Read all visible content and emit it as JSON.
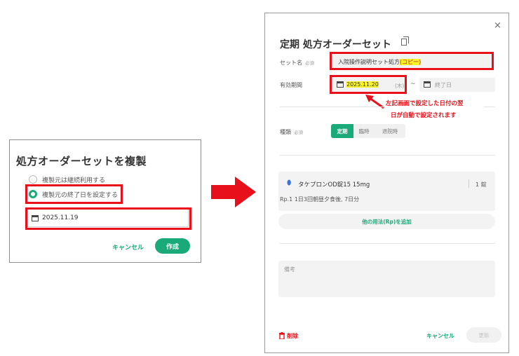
{
  "left_dialog": {
    "title": "処方オーダーセットを複製",
    "options": [
      {
        "label": "複製元は継続利用する",
        "selected": false
      },
      {
        "label": "複製元の終了日を設定する",
        "selected": true
      }
    ],
    "date_value": "2025.11.19",
    "cancel_label": "キャンセル",
    "create_label": "作成"
  },
  "right_dialog": {
    "close_label": "×",
    "title": "定期 処方オーダーセット",
    "set_name": {
      "label": "セット名",
      "required": "必須",
      "value_main": "入院操作説明セット処方",
      "value_suffix": "(コピー)"
    },
    "valid_period": {
      "label": "有効期間",
      "start_date": "2025.11.20",
      "start_weekday": "(木)",
      "separator": "~",
      "end_placeholder": "終了日"
    },
    "annotation": {
      "line1": "左記画面で設定した日付の翌",
      "line2": "日が自動で設定されます"
    },
    "type": {
      "label": "種類",
      "required": "必須",
      "options": [
        "定期",
        "臨時",
        "退院時"
      ],
      "active_index": 0
    },
    "prescription": {
      "drug": "タケプロンOD錠15 15mg",
      "quantity": "1 錠",
      "rp_text": "Rp.1  1日3回朝昼夕食後, 7日分"
    },
    "add_rp_label": "他の用法(Rp)を追加",
    "notes_placeholder": "備考",
    "delete_label": "削除",
    "cancel_label": "キャンセル",
    "update_label": "更新"
  },
  "colors": {
    "accent": "#1aa978",
    "highlight_red": "#e8101a",
    "highlight_yellow": "#f7f22a"
  },
  "icons": [
    "calendar-icon",
    "copy-icon",
    "close-icon",
    "pill-icon",
    "trash-icon"
  ]
}
